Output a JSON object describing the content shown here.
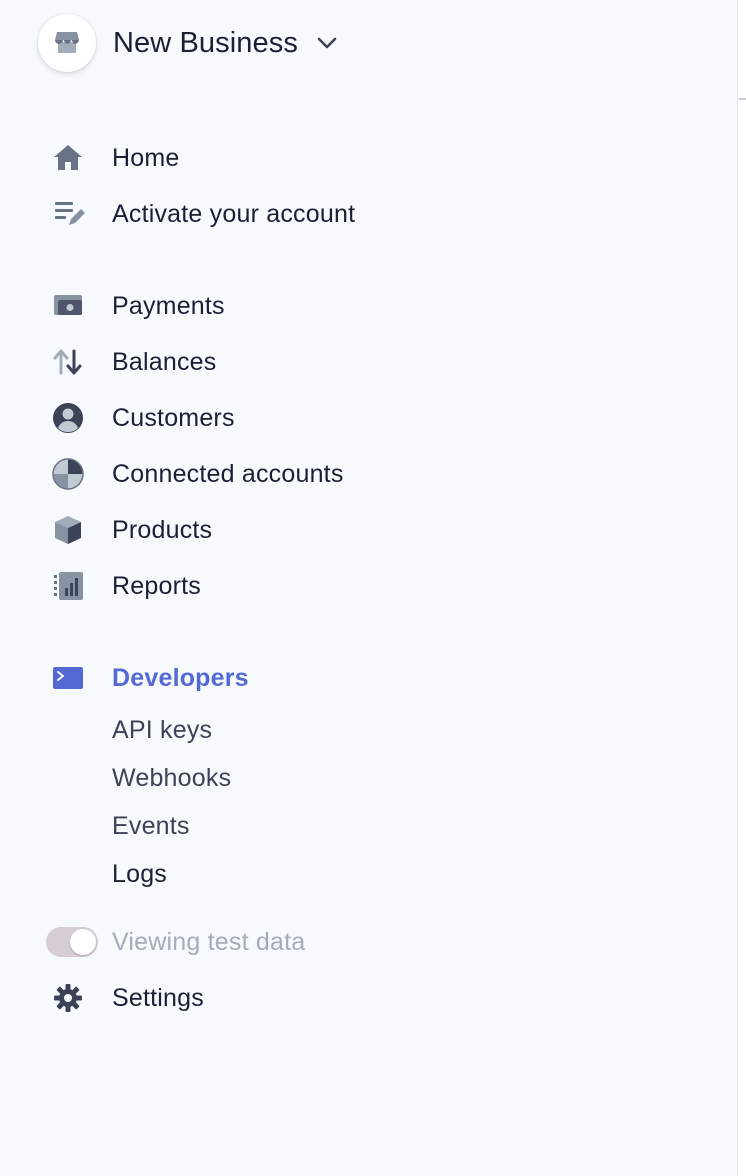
{
  "account": {
    "name": "New Business",
    "avatar_icon": "store-icon",
    "dropdown_icon": "chevron-down-icon"
  },
  "nav": {
    "primary": [
      {
        "label": "Home",
        "icon": "home-icon"
      },
      {
        "label": "Activate your account",
        "icon": "checklist-edit-icon"
      }
    ],
    "main": [
      {
        "label": "Payments",
        "icon": "payments-icon"
      },
      {
        "label": "Balances",
        "icon": "balances-arrows-icon"
      },
      {
        "label": "Customers",
        "icon": "customer-icon"
      },
      {
        "label": "Connected accounts",
        "icon": "connected-accounts-icon"
      },
      {
        "label": "Products",
        "icon": "product-box-icon"
      },
      {
        "label": "Reports",
        "icon": "reports-icon"
      }
    ],
    "developers": {
      "label": "Developers",
      "icon": "terminal-icon",
      "sub_items": [
        "API keys",
        "Webhooks",
        "Events",
        "Logs"
      ]
    },
    "test_data": {
      "label": "Viewing test data",
      "enabled": true
    },
    "settings": {
      "label": "Settings",
      "icon": "gear-icon"
    }
  },
  "colors": {
    "background": "#f7fafc",
    "text_primary": "#1a1f36",
    "text_secondary": "#3c4257",
    "icon": "#697386",
    "active": "#5469d4",
    "muted": "#a3acb9"
  }
}
